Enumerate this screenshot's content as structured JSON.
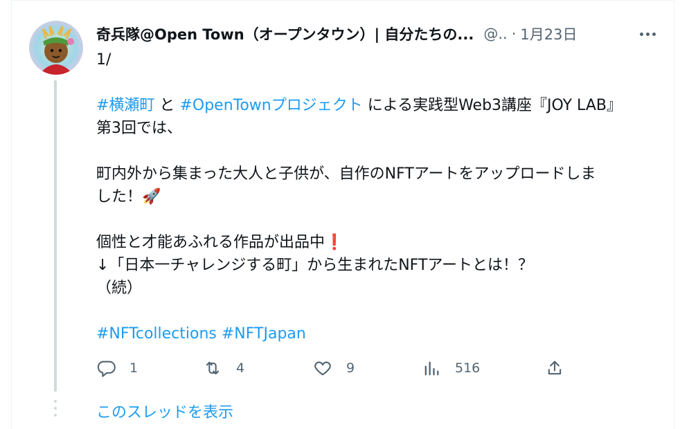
{
  "tweet": {
    "author_name": "奇兵隊@Open Town（オープンタウン）| 自分たちの...",
    "handle": "@..",
    "separator": "·",
    "date": "1月23日",
    "lines": [
      [
        {
          "t": "1/"
        }
      ],
      [
        {
          "t": ""
        }
      ],
      [
        {
          "t": "#横瀬町",
          "tag": true
        },
        {
          "t": " と "
        },
        {
          "t": "#OpenTownプロジェクト",
          "tag": true
        },
        {
          "t": " による実践型Web3講座『JOY LAB』"
        }
      ],
      [
        {
          "t": "第3回では、"
        }
      ],
      [
        {
          "t": ""
        }
      ],
      [
        {
          "t": "町内外から集まった大人と子供が、自作のNFTアートをアップロードしま"
        }
      ],
      [
        {
          "t": "した！🚀"
        }
      ],
      [
        {
          "t": ""
        }
      ],
      [
        {
          "t": "個性と才能あふれる作品が出品中❗"
        }
      ],
      [
        {
          "t": "↓「日本一チャレンジする町」から生まれたNFTアートとは！？"
        }
      ],
      [
        {
          "t": "（続）"
        }
      ],
      [
        {
          "t": ""
        }
      ],
      [
        {
          "t": "#NFTcollections",
          "tag": true
        },
        {
          "t": " "
        },
        {
          "t": "#NFTJapan",
          "tag": true
        }
      ]
    ],
    "actions": {
      "reply_count": "1",
      "retweet_count": "4",
      "like_count": "9",
      "views_count": "516"
    },
    "show_thread_label": "このスレッドを表示"
  },
  "colors": {
    "link": "#1d9bf0",
    "muted": "#536471",
    "text": "#0f1419",
    "thread_line": "#cfd9de"
  },
  "icons": [
    "reply-icon",
    "retweet-icon",
    "like-icon",
    "views-icon",
    "share-icon",
    "more-icon"
  ]
}
